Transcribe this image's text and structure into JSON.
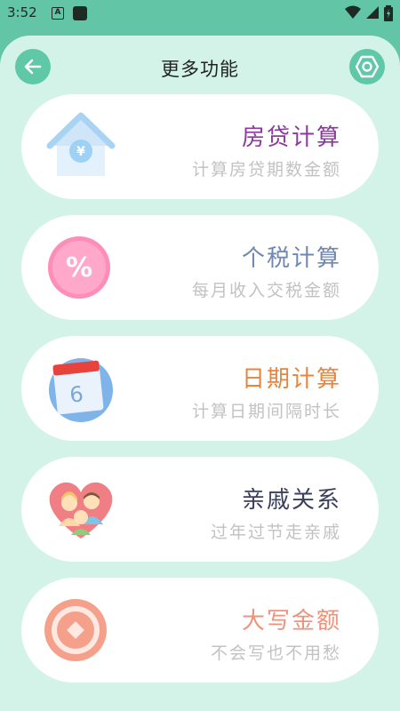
{
  "status_bar": {
    "time": "3:52",
    "notification_letter": "A"
  },
  "header": {
    "title": "更多功能",
    "back_icon": "arrow-left-icon",
    "settings_icon": "hexagon-settings-icon"
  },
  "colors": {
    "accent": "#5fc8a6",
    "background": "#d3f3e8"
  },
  "cards": [
    {
      "title": "房贷计算",
      "subtitle": "计算房贷期数金额",
      "icon": "house-yen-icon",
      "title_color": "#8b3a9e"
    },
    {
      "title": "个税计算",
      "subtitle": "每月收入交税金额",
      "icon": "percent-icon",
      "title_color": "#6f87b3"
    },
    {
      "title": "日期计算",
      "subtitle": "计算日期间隔时长",
      "icon": "calendar-icon",
      "title_color": "#e8853c"
    },
    {
      "title": "亲戚关系",
      "subtitle": "过年过节走亲戚",
      "icon": "family-heart-icon",
      "title_color": "#3a3f5c"
    },
    {
      "title": "大写金额",
      "subtitle": "不会写也不用愁",
      "icon": "coin-icon",
      "title_color": "#f0917a"
    }
  ]
}
